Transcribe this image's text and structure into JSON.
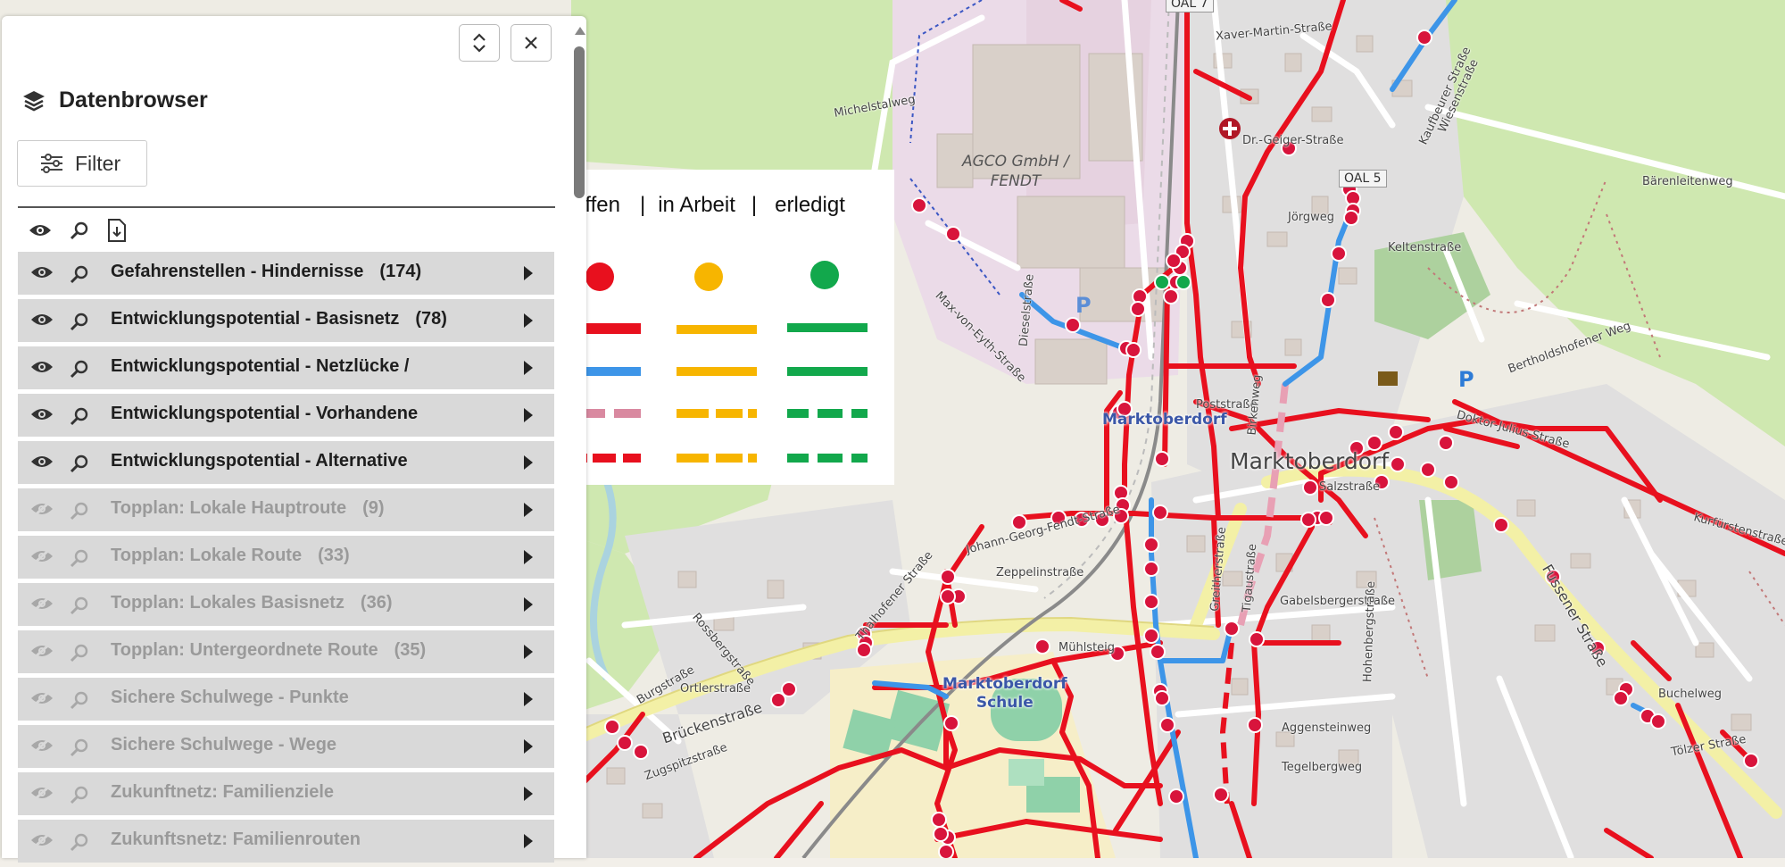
{
  "panel": {
    "title": "Datenbrowser",
    "filter_label": "Filter",
    "layers": [
      {
        "name": "Gefahrenstellen - Hindernisse",
        "count": "(174)",
        "visible": true
      },
      {
        "name": "Entwicklungspotential - Basisnetz",
        "count": "(78)",
        "visible": true
      },
      {
        "name": "Entwicklungspotential - Netzlücke /",
        "count": "",
        "visible": true
      },
      {
        "name": "Entwicklungspotential - Vorhandene",
        "count": "",
        "visible": true
      },
      {
        "name": "Entwicklungspotential - Alternative",
        "count": "",
        "visible": true
      },
      {
        "name": "Topplan: Lokale Hauptroute",
        "count": "(9)",
        "visible": false
      },
      {
        "name": "Topplan: Lokale Route",
        "count": "(33)",
        "visible": false
      },
      {
        "name": "Topplan: Lokales Basisnetz",
        "count": "(36)",
        "visible": false
      },
      {
        "name": "Topplan: Untergeordnete Route",
        "count": "(35)",
        "visible": false
      },
      {
        "name": "Sichere Schulwege - Punkte",
        "count": "",
        "visible": false
      },
      {
        "name": "Sichere Schulwege - Wege",
        "count": "",
        "visible": false
      },
      {
        "name": "Zukunftnetz: Familienziele",
        "count": "",
        "visible": false
      },
      {
        "name": "Zukunftsnetz: Familienrouten",
        "count": "",
        "visible": false
      }
    ]
  },
  "legend": {
    "status_open": "offen",
    "status_in_progress": "in Arbeit",
    "status_done": "erledigt",
    "separator": "|",
    "colors": {
      "open": "#e8101e",
      "in_progress": "#f7b500",
      "done": "#12a84c",
      "blue": "#3d95e8",
      "pink": "#d989a0"
    }
  },
  "map": {
    "town_label": "Marktoberdorf",
    "company_label_1": "AGCO GmbH /",
    "company_label_2": "FENDT",
    "station_label": "Marktoberdorf",
    "school_label_1": "Marktoberdorf",
    "school_label_2": "Schule",
    "road_badge_1": "OAL 5",
    "road_badge_2": "OAL 7",
    "streets": [
      "Xaver-Martin-Straße",
      "Dr.-Geiger-Straße",
      "Kaufbeurer Straße",
      "Wiesenstraße",
      "Keltenstraße",
      "Jörgweg",
      "Bärenleitenweg",
      "Max-von-Eyth-Straße",
      "Dieselstraße",
      "Poststraße",
      "Birkenweg",
      "Doktor-Julius-Straße",
      "Bertholdshofener Weg",
      "Zeppelinstraße",
      "Johann-Georg-Fendt-Straße",
      "Mühlsteig",
      "Brückenstraße",
      "Ortlerstraße",
      "Burgstraße",
      "Thalhofener Straße",
      "Gabelsbergerstraße",
      "Aggensteinweg",
      "Tegelbergweg",
      "Buchelweg",
      "Fussener Straße",
      "Tölzer Straße",
      "Michelstalweg",
      "Rossbergstraße",
      "Zugspitzstraße",
      "Greitherstraße",
      "Tigaustraße",
      "Hohenbergstraße",
      "Salzstraße",
      "Kurfürstenstraße"
    ]
  }
}
